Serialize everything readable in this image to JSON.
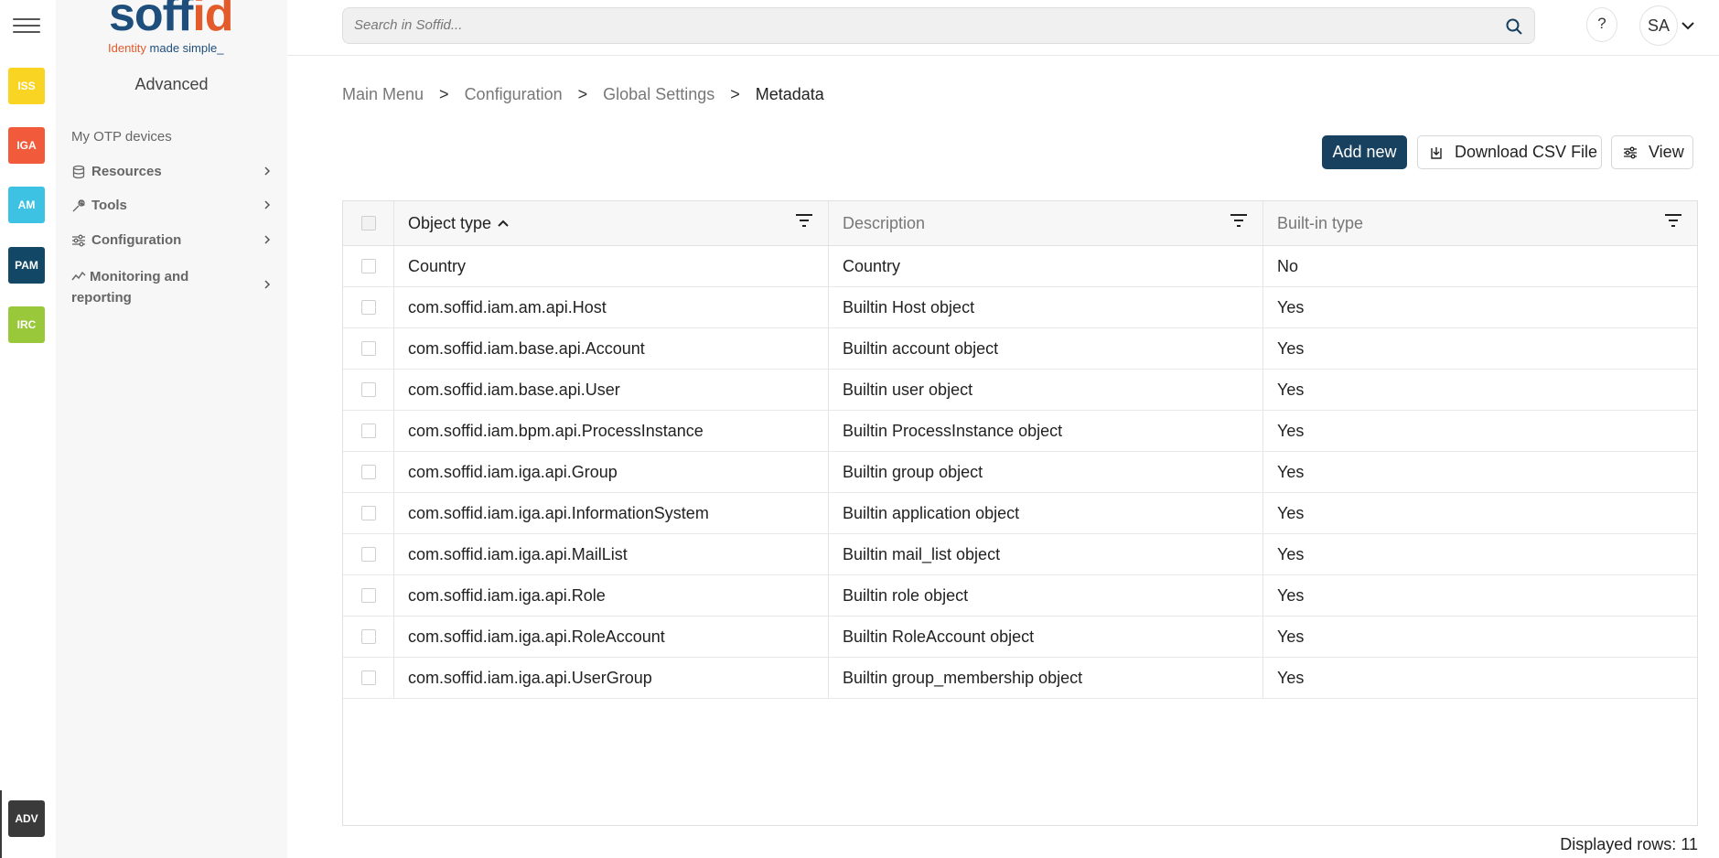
{
  "rail": {
    "apps": [
      {
        "label": "ISS",
        "color": "#f9d423",
        "text_color": "#ffffff"
      },
      {
        "label": "IGA",
        "color": "#f15a3b",
        "text_color": "#ffffff"
      },
      {
        "label": "AM",
        "color": "#3ec2e3",
        "text_color": "#ffffff"
      },
      {
        "label": "PAM",
        "color": "#124766",
        "text_color": "#ffffff"
      },
      {
        "label": "IRC",
        "color": "#9ac83b",
        "text_color": "#ffffff"
      }
    ],
    "bottom_app": {
      "label": "ADV",
      "color": "#3a3a3a"
    }
  },
  "logo": {
    "word_main": "soff",
    "word_accent": "id",
    "tag_part1": "Identity",
    "tag_part2": " made simple_"
  },
  "sidenav": {
    "title": "Advanced",
    "link": "My OTP devices",
    "items": [
      {
        "label": "Resources",
        "icon": "database-icon"
      },
      {
        "label": "Tools",
        "icon": "wrench-icon"
      },
      {
        "label": "Configuration",
        "icon": "sliders-icon"
      },
      {
        "label": "Monitoring and reporting",
        "icon": "chart-line-icon"
      }
    ]
  },
  "topbar": {
    "search_placeholder": "Search in Soffid...",
    "help_label": "?",
    "user_initials": "SA"
  },
  "breadcrumb": {
    "items": [
      "Main Menu",
      "Configuration",
      "Global Settings",
      "Metadata"
    ],
    "separator": ">"
  },
  "toolbar": {
    "add_label": "Add new",
    "download_label": "Download CSV File",
    "view_label": "View",
    "primary_color": "#18405f"
  },
  "table": {
    "columns": [
      "Object type",
      "Description",
      "Built-in type"
    ],
    "sorted_column": "Object type",
    "sort_direction": "ascending",
    "rows": [
      {
        "object_type": "Country",
        "description": "Country",
        "builtin": "No"
      },
      {
        "object_type": "com.soffid.iam.am.api.Host",
        "description": "Builtin Host object",
        "builtin": "Yes"
      },
      {
        "object_type": "com.soffid.iam.base.api.Account",
        "description": "Builtin account object",
        "builtin": "Yes"
      },
      {
        "object_type": "com.soffid.iam.base.api.User",
        "description": "Builtin user object",
        "builtin": "Yes"
      },
      {
        "object_type": "com.soffid.iam.bpm.api.ProcessInstance",
        "description": "Builtin ProcessInstance object",
        "builtin": "Yes"
      },
      {
        "object_type": "com.soffid.iam.iga.api.Group",
        "description": "Builtin group object",
        "builtin": "Yes"
      },
      {
        "object_type": "com.soffid.iam.iga.api.InformationSystem",
        "description": "Builtin application object",
        "builtin": "Yes"
      },
      {
        "object_type": "com.soffid.iam.iga.api.MailList",
        "description": "Builtin mail_list object",
        "builtin": "Yes"
      },
      {
        "object_type": "com.soffid.iam.iga.api.Role",
        "description": "Builtin role object",
        "builtin": "Yes"
      },
      {
        "object_type": "com.soffid.iam.iga.api.RoleAccount",
        "description": "Builtin RoleAccount object",
        "builtin": "Yes"
      },
      {
        "object_type": "com.soffid.iam.iga.api.UserGroup",
        "description": "Builtin group_membership object",
        "builtin": "Yes"
      }
    ]
  },
  "footer": {
    "displayed_rows": "Displayed rows: 11"
  }
}
